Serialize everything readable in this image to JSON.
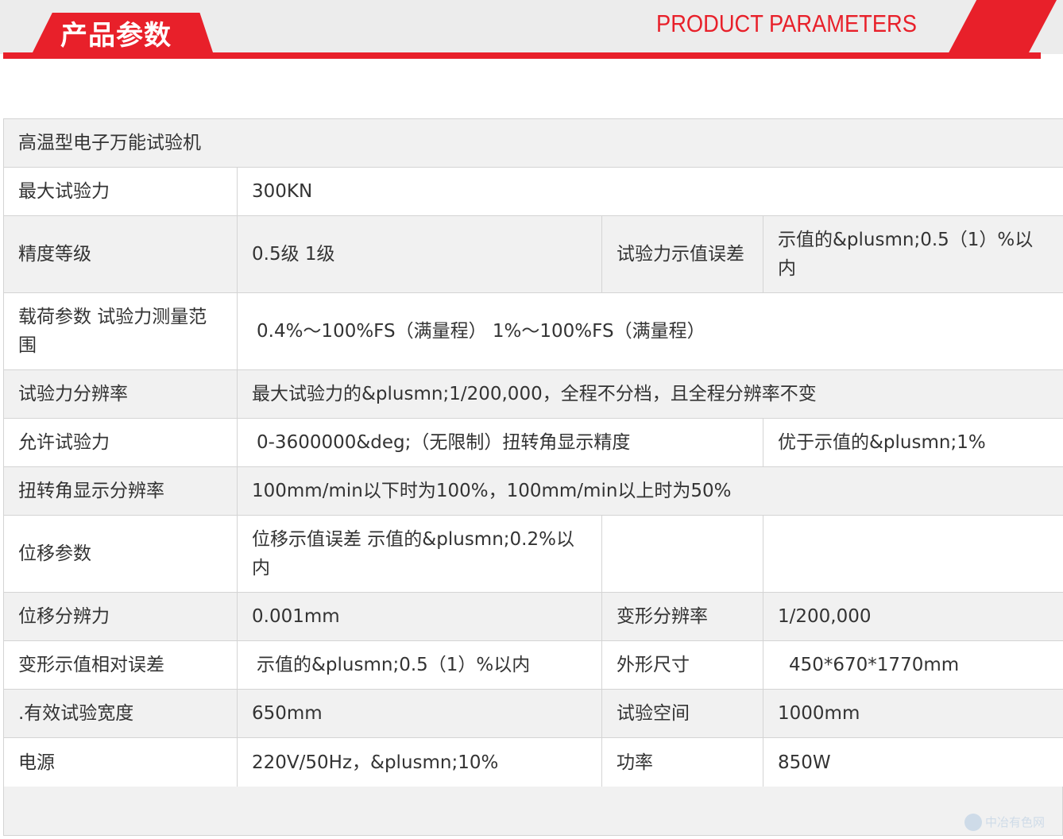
{
  "header": {
    "title_cn": "产品参数",
    "title_en": "PRODUCT PARAMETERS",
    "accent_color": "#e8202a"
  },
  "table": {
    "title": "高温型电子万能试验机",
    "rows": [
      {
        "label": "最大试验力",
        "value": "300KN"
      },
      {
        "label": "精度等级",
        "value": "0.5级  1级",
        "label2": "试验力示值误差",
        "value2": "示值的&plusmn;0.5（1）%以内"
      },
      {
        "label": "载荷参数 试验力测量范围",
        "value": "0.4%～100%FS（满量程）  1%～100%FS（满量程）"
      },
      {
        "label": "试验力分辨率",
        "value": "最大试验力的&plusmn;1/200,000，全程不分档，且全程分辨率不变"
      },
      {
        "label": "允许试验力",
        "value": "0-3600000&deg;（无限制）扭转角显示精度",
        "value2": "优于示值的&plusmn;1%"
      },
      {
        "label": "扭转角显示分辨率",
        "value": "100mm/min以下时为100%，100mm/min以上时为50%"
      },
      {
        "label": "位移参数",
        "value": "位移示值误差 示值的&plusmn;0.2%以内",
        "label2": "",
        "value2": ""
      },
      {
        "label": "位移分辨力",
        "value": "0.001mm",
        "label2": "变形分辨率",
        "value2": "1/200,000"
      },
      {
        "label": "变形示值相对误差",
        "value": "示值的&plusmn;0.5（1）%以内",
        "label2": "外形尺寸",
        "value2": "450*670*1770mm"
      },
      {
        "label": ".有效试验宽度",
        "value": "650mm",
        "label2": "试验空间",
        "value2": "1000mm"
      },
      {
        "label": "电源",
        "value": "220V/50Hz，&plusmn;10%",
        "label2": "功率",
        "value2": "850W"
      }
    ]
  },
  "watermark": {
    "text": "中冶有色网",
    "icon": "globe-logo-icon"
  }
}
